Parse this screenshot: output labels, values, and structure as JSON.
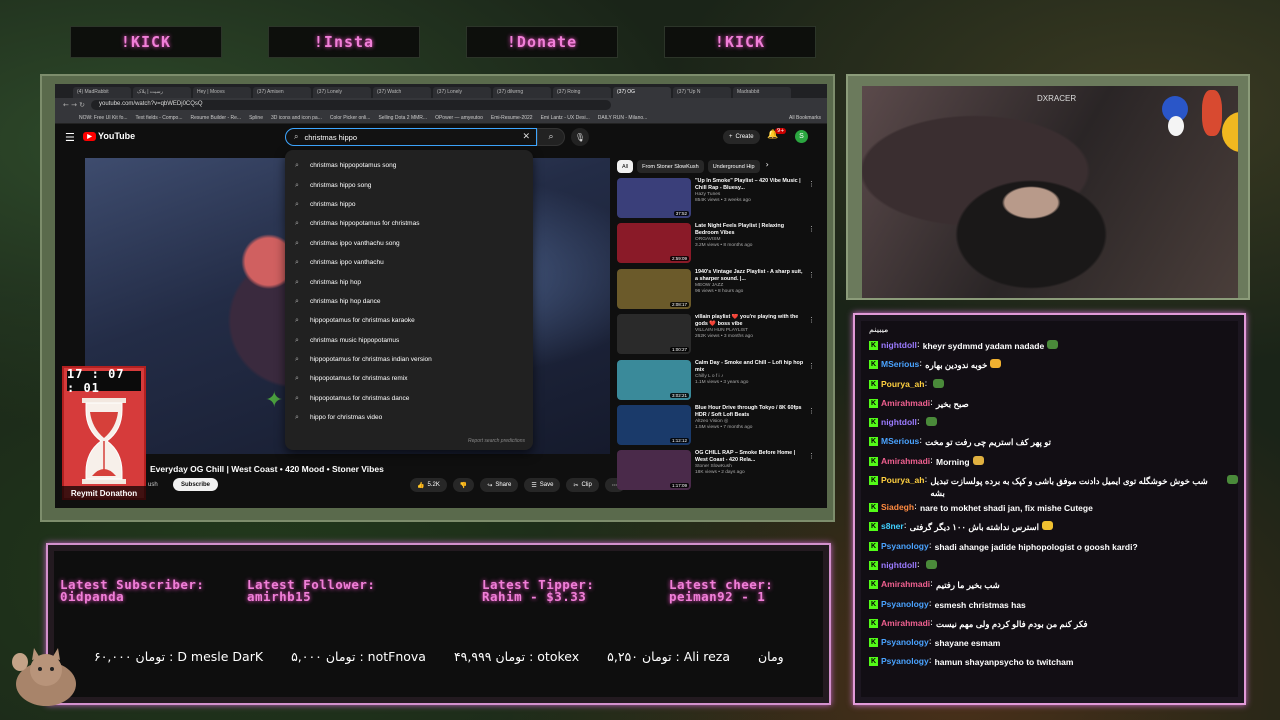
{
  "top_buttons": [
    "!KICK",
    "!Insta",
    "!Donate",
    "!KICK"
  ],
  "browser": {
    "tabs": [
      "(4) MadRabbit",
      "رسیت | پلاک",
      "Hey | Moovs",
      "(37) Amisen",
      "(37) Lonely",
      "(37) Watch",
      "(37) Lonely",
      "(37) dilwrng",
      "(37) Roing",
      "(37) OG",
      "(37) \"Up N",
      "Madrabbit"
    ],
    "url": "youtube.com/watch?v=qbWEDj0CQsQ",
    "bookmarks": [
      "NOW: Free UI Kit fo...",
      "Text fields - Compo...",
      "Resume Builder - Re...",
      "Spline",
      "3D icons and icon pa...",
      "Color Picker onli...",
      "Selling Dota 2 MMR...",
      "OPower — amyeutoo",
      "Emi-Resume-2022",
      "Emi Lantz - UX Desi...",
      "DAILY RUN - Milano..."
    ],
    "all_bookmarks": "All Bookmarks"
  },
  "youtube": {
    "logo": "YouTube",
    "search_value": "christmas hippo",
    "create_label": "Create",
    "bell_count": "9+",
    "avatar_letter": "S",
    "suggestions": [
      "christmas hippopotamus song",
      "christmas hippo song",
      "christmas hippo",
      "christmas hippopotamus for christmas",
      "christmas ippo vanthachu song",
      "christmas ippo vanthachu",
      "christmas hip hop",
      "christmas hip hop dance",
      "hippopotamus for christmas karaoke",
      "christmas music hippopotamus",
      "hippopotamus for christmas indian version",
      "hippopotamus for christmas remix",
      "hippopotamus for christmas dance",
      "hippo for christmas video"
    ],
    "report_label": "Report search predictions",
    "video_title": "Everyday OG Chill | West Coast • 420 Mood • Stoner Vibes",
    "channel_fragment": "ush",
    "subscribe_label": "Subscribe",
    "actions": {
      "like": "5.2K",
      "share": "Share",
      "save": "Save",
      "clip": "Clip"
    },
    "chips": [
      "All",
      "From Stoner SlowKush",
      "Underground Hip"
    ],
    "recommendations": [
      {
        "title": "\"Up In Smoke\" Playlist – 420 Vibe Music | Chill Rap - Bluesy...",
        "channel": "Hazy Tunes",
        "meta": "854K views • 3 weeks ago",
        "duration": "37:52",
        "color": "#3a3f7a"
      },
      {
        "title": "Late Night Feels Playlist | Relaxing Bedroom Vibes",
        "channel": "ORGAVISM",
        "meta": "3.2M views • 8 months ago",
        "duration": "2:59:09",
        "color": "#8a1a28"
      },
      {
        "title": "1940's Vintage Jazz Playlist - A sharp suit, a sharper sound. |...",
        "channel": "MEOW JAZZ",
        "meta": "96 views • 8 hours ago",
        "duration": "2:08:17",
        "color": "#6b5a2a"
      },
      {
        "title": "villain playlist ❤️ you're playing with the gods ❤️ boss vibe",
        "channel": "VILLAIN HUN PLAYLIST",
        "meta": "262K views • 3 months ago",
        "duration": "1:00:27",
        "color": "#2a2a2a"
      },
      {
        "title": "Calm Day - Smoke and Chill – Lofi hip hop mix",
        "channel": "Chilly L o f i ♪",
        "meta": "1.1M views • 3 years ago",
        "duration": "3:02:21",
        "color": "#3a8a9a"
      },
      {
        "title": "Blue Hour Drive through Tokyo / 8K 60fps HDR / Soft Lofi Beats",
        "channel": "Altzeo Vision ◎",
        "meta": "1.5M views • 7 months ago",
        "duration": "1:12:12",
        "color": "#1a3a6a"
      },
      {
        "title": "OG CHILL RAP – Smoke Before Home | West Coast - 420 Rela...",
        "channel": "Stoner SlowKush",
        "meta": "18K views • 2 days ago",
        "duration": "1:17:09",
        "color": "#4a2a4a"
      }
    ]
  },
  "timer": {
    "display": "17 : 07 : 01",
    "label": "Reymit Donathon"
  },
  "webcam": {
    "chair_text": "DXRACER"
  },
  "chat": {
    "top_text": "میبینم",
    "kick_badge": "K",
    "messages": [
      {
        "user": "nightdoll",
        "color": "#9b7bff",
        "text": "kheyr sydmmd yadam nadade",
        "emote": "#4a8a3a"
      },
      {
        "user": "MSerious",
        "color": "#4aa3ff",
        "text": "خوبه ندودین بهاره",
        "emote": "#f0b030"
      },
      {
        "user": "Pourya_ah",
        "color": "#ffd040",
        "text": "",
        "emote": "#4a8a3a"
      },
      {
        "user": "Amirahmadi",
        "color": "#f06090",
        "text": "صبح بخیر",
        "emote": ""
      },
      {
        "user": "nightdoll",
        "color": "#9b7bff",
        "text": "",
        "emote": "#4a8a3a"
      },
      {
        "user": "MSerious",
        "color": "#4aa3ff",
        "text": "تو پهر کف استریم چی رفت تو مخت",
        "emote": ""
      },
      {
        "user": "Amirahmadi",
        "color": "#f06090",
        "text": "Morning",
        "emote": "#e0b040"
      },
      {
        "user": "Pourya_ah",
        "color": "#ffd040",
        "text": "شب خوش خوشگله توی ایمیل دادنت موفق باشی و کپک به برده پولسازت تبدیل بشه",
        "emote": "#4a8a3a"
      },
      {
        "user": "Siadegh",
        "color": "#ff8a40",
        "text": "nare to mokhet shadi jan, fix mishe Cutege",
        "emote": ""
      },
      {
        "user": "s8ner",
        "color": "#40d0ff",
        "text": "استرس نداشته باش ۱۰۰ دیگر گرفتی",
        "emote": "#f0c030"
      },
      {
        "user": "Psyanology",
        "color": "#4aa3ff",
        "text": "shadi ahange jadide hiphopologist o goosh kardi?",
        "emote": ""
      },
      {
        "user": "nightdoll",
        "color": "#9b7bff",
        "text": "",
        "emote": "#4a8a3a"
      },
      {
        "user": "Amirahmadi",
        "color": "#f06090",
        "text": "شب بخیر ما رفتیم",
        "emote": ""
      },
      {
        "user": "Psyanology",
        "color": "#4aa3ff",
        "text": "esmesh christmas has",
        "emote": ""
      },
      {
        "user": "Amirahmadi",
        "color": "#f06090",
        "text": "فکر کنم من بودم فالو کردم ولی مهم نیست",
        "emote": ""
      },
      {
        "user": "Psyanology",
        "color": "#4aa3ff",
        "text": "shayane esmam",
        "emote": ""
      },
      {
        "user": "Psyanology",
        "color": "#4aa3ff",
        "text": "hamun shayanpsycho to twitcham",
        "emote": ""
      }
    ]
  },
  "info_panel": {
    "latest_subscriber_label": "Latest Subscriber:",
    "latest_subscriber": "0idpanda",
    "latest_follower_label": "Latest Follower:",
    "latest_follower": "amirhb15",
    "latest_tipper_label": "Latest Tipper:",
    "latest_tipper": "Rahim - $3.33",
    "latest_cheer_label": "Latest cheer:",
    "latest_cheer": "peiman92 - 1",
    "ticker": [
      "۶۰,۰۰۰ تومان : D mesle DarK",
      "۵,۰۰۰ تومان : notFnova",
      "۴۹,۹۹۹ تومان : otokex",
      "۵,۲۵۰ تومان : Ali reza",
      "ومان"
    ]
  },
  "colors": {
    "accent_pink": "#f07fd8",
    "kick_green": "#53fc18",
    "youtube_red": "#ff0000"
  }
}
